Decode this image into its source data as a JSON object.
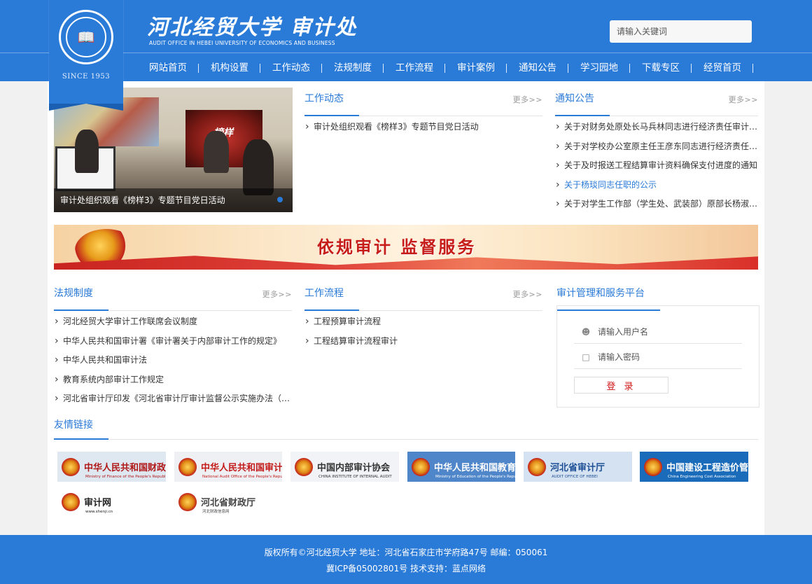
{
  "header": {
    "title": "河北经贸大学 审计处",
    "subtitle": "AUDIT OFFICE IN HEBEI UNIVERSITY OF ECONOMICS AND BUSINESS",
    "since": "SINCE 1953",
    "search_placeholder": "请输入关键词"
  },
  "nav": [
    "网站首页",
    "机构设置",
    "工作动态",
    "法规制度",
    "工作流程",
    "审计案例",
    "通知公告",
    "学习园地",
    "下载专区",
    "经贸首页"
  ],
  "slideshow": {
    "caption": "审计处组织观看《榜样3》专题节目党日活动",
    "screen_text": "榜样"
  },
  "work_news": {
    "title": "工作动态",
    "more": "更多>>",
    "items": [
      "审计处组织观看《榜样3》专题节目党日活动"
    ]
  },
  "notices": {
    "title": "通知公告",
    "more": "更多>>",
    "items": [
      "关于对财务处原处长马兵林同志进行经济责任审计的公示",
      "关于对学校办公室原主任王彦东同志进行经济责任审计的公示",
      "关于及时报送工程结算审计资料确保支付进度的通知",
      "关于杨琰同志任职的公示",
      "关于对学生工作部（学生处、武装部）原部长杨淑珍同志进行经济责任审计的公示"
    ],
    "highlight_index": 3
  },
  "banner": {
    "text": "依规审计  监督服务"
  },
  "regulations": {
    "title": "法规制度",
    "more": "更多>>",
    "items": [
      "河北经贸大学审计工作联席会议制度",
      "中华人民共和国审计署《审计署关于内部审计工作的规定》",
      "中华人民共和国审计法",
      "教育系统内部审计工作规定",
      "河北省审计厅印发《河北省审计厅审计监督公示实施办法（试行）》"
    ]
  },
  "workflow": {
    "title": "工作流程",
    "more": "更多>>",
    "items": [
      "工程预算审计流程",
      "工程结算审计流程审计"
    ]
  },
  "platform": {
    "title": "审计管理和服务平台",
    "username_placeholder": "请输入用户名",
    "password_placeholder": "请输入密码",
    "login_label": "登 录"
  },
  "links": {
    "title": "友情链接",
    "tiles": [
      {
        "name": "中华人民共和国财政部",
        "sub": "Ministry of Finance of the People's Republic of China",
        "bg": "#dfe7f1",
        "color": "#b01818"
      },
      {
        "name": "中华人民共和国审计署",
        "sub": "National Audit Office of the People's Republic of China",
        "bg": "#eef0f3",
        "color": "#c41a1a"
      },
      {
        "name": "中国内部审计协会",
        "sub": "CHINA INSTITUTE OF INTERNAL AUDIT",
        "bg": "#f1f3f6",
        "color": "#333333"
      },
      {
        "name": "中华人民共和国教育部",
        "sub": "Ministry of Education of the People's Republic of China",
        "bg": "#4f86c9",
        "color": "#ffffff"
      },
      {
        "name": "河北省审计厅",
        "sub": "AUDIT OFFICE OF HEBEI",
        "bg": "#d5e2f1",
        "color": "#1d4f96"
      },
      {
        "name": "中国建设工程造价管理协会",
        "sub": "China Engineering Cost Association",
        "bg": "#1a6cba",
        "color": "#ffffff"
      },
      {
        "name": "审计网",
        "sub": "www.shenji.cn",
        "bg": "#ffffff",
        "color": "#222222"
      },
      {
        "name": "河北省财政厅",
        "sub": "河北财政信息网",
        "bg": "#ffffff",
        "color": "#444444"
      }
    ]
  },
  "footer": {
    "line1": "版权所有©河北经贸大学 地址：河北省石家庄市学府路47号 邮编：050061",
    "line2": "冀ICP备05002801号 技术支持：蓝点网络"
  },
  "colors": {
    "primary": "#2a7ad8",
    "banner_red": "#c71d1a"
  }
}
